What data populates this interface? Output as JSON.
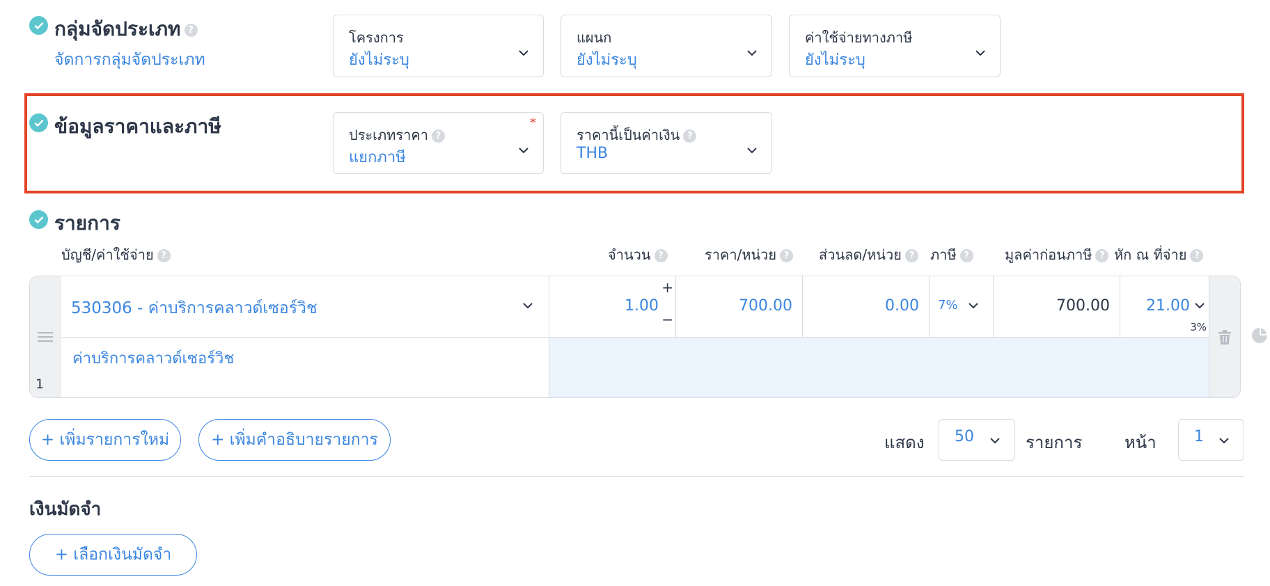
{
  "classification": {
    "title": "กลุ่มจัดประเภท",
    "manage_link": "จัดการกลุ่มจัดประเภท",
    "fields": [
      {
        "label": "โครงการ",
        "value": "ยังไม่ระบุ"
      },
      {
        "label": "แผนก",
        "value": "ยังไม่ระบุ"
      },
      {
        "label": "ค่าใช้จ่ายทางภาษี",
        "value": "ยังไม่ระบุ"
      }
    ]
  },
  "pricing": {
    "title": "ข้อมูลราคาและภาษี",
    "price_type_label": "ประเภทราคา",
    "price_type_value": "แยกภาษี",
    "required_mark": "*",
    "currency_label": "ราคานี้เป็นค่าเงิน",
    "currency_value": "THB"
  },
  "items": {
    "title": "รายการ",
    "columns": {
      "account": "บัญชี/ค่าใช้จ่าย",
      "qty": "จำนวน",
      "price": "ราคา/หน่วย",
      "discount": "ส่วนลด/หน่วย",
      "vat": "ภาษี",
      "pretax": "มูลค่าก่อนภาษี",
      "wht": "หัก ณ ที่จ่าย"
    },
    "rows": [
      {
        "index": "1",
        "account": "530306 - ค่าบริการคลาวด์เซอร์วิช",
        "qty": "1.00",
        "price": "700.00",
        "discount": "0.00",
        "vat": "7%",
        "pretax": "700.00",
        "wht": "21.00",
        "wht_rate": "3%",
        "description": "ค่าบริการคลาวด์เซอร์วิช"
      }
    ],
    "add_item": "+ เพิ่มรายการใหม่",
    "add_description": "+ เพิ่มคำอธิบายรายการ",
    "show_label": "แสดง",
    "per_page": "50",
    "items_label": "รายการ",
    "page_label": "หน้า",
    "page": "1"
  },
  "deposit": {
    "title": "เงินมัดจำ",
    "select_button": "+ เลือกเงินมัดจำ"
  },
  "colors": {
    "accent": "#3b86e0",
    "check": "#5cc6cf",
    "highlight": "#e34327"
  }
}
